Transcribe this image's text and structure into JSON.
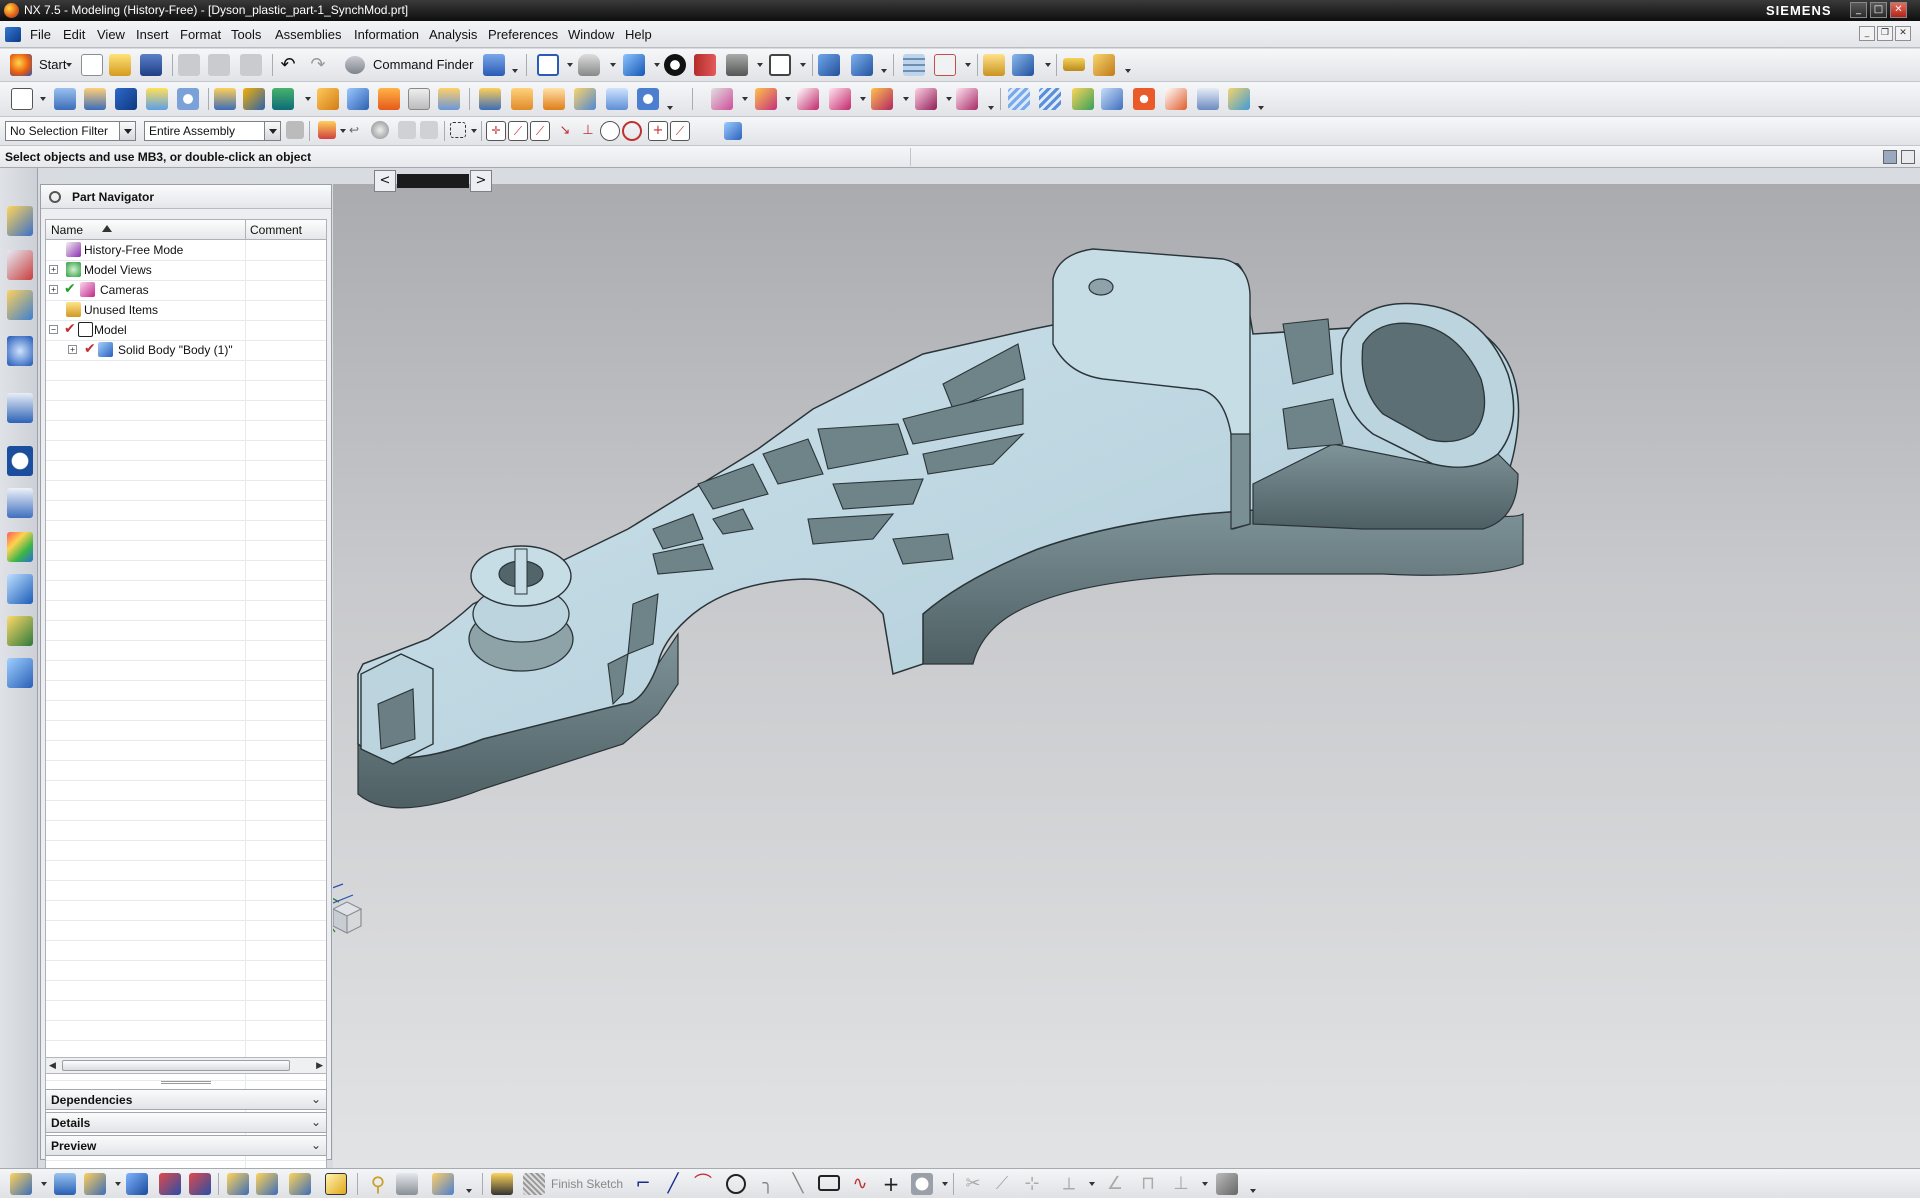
{
  "window": {
    "title": "NX 7.5 - Modeling (History-Free) - [Dyson_plastic_part-1_SynchMod.prt]",
    "brand": "SIEMENS",
    "controls": [
      "_",
      "□",
      "✕"
    ]
  },
  "menubar": {
    "items": [
      "File",
      "Edit",
      "View",
      "Insert",
      "Format",
      "Tools",
      "Assemblies",
      "Information",
      "Analysis",
      "Preferences",
      "Window",
      "Help"
    ]
  },
  "toolbar_standard": {
    "start_label": "Start",
    "command_finder_label": "Command Finder"
  },
  "selection_bar": {
    "filter_value": "No Selection Filter",
    "scope_value": "Entire Assembly"
  },
  "cue_line": {
    "text": "Select objects and use MB3, or double-click an object"
  },
  "part_navigator": {
    "title": "Part Navigator",
    "columns": [
      "Name",
      "Comment"
    ],
    "rows": [
      {
        "label": "History-Free Mode",
        "expander": "",
        "checked": false,
        "icon": "history-free-icon"
      },
      {
        "label": "Model Views",
        "expander": "+",
        "checked": false,
        "icon": "model-views-icon"
      },
      {
        "label": "Cameras",
        "expander": "+",
        "checked": true,
        "icon": "cameras-icon"
      },
      {
        "label": "Unused Items",
        "expander": "",
        "checked": false,
        "icon": "folder-icon"
      },
      {
        "label": "Model",
        "expander": "−",
        "checked": true,
        "icon": "model-icon"
      },
      {
        "label": "Solid Body \"Body (1)\"",
        "expander": "+",
        "checked": true,
        "icon": "solid-body-icon"
      }
    ],
    "panels": [
      "Dependencies",
      "Details",
      "Preview"
    ]
  },
  "sketch_toolbar": {
    "finish_sketch_label": "Finish Sketch"
  },
  "colors": {
    "part_face": "#bed6e0",
    "part_side": "#5f7378",
    "part_edge": "#2a3438",
    "viewport_top": "#a9abaf",
    "viewport_bottom": "#e2e3e5"
  }
}
